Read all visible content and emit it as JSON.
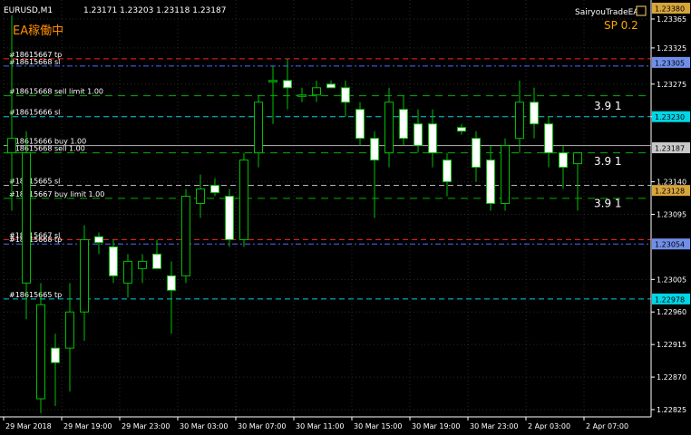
{
  "symbol_header": "EURUSD,M1",
  "ohlc": "1.23171 1.23203 1.23118 1.23187",
  "ea_status": "EA稼働中",
  "ea_name": "SairyouTradeEA",
  "spread_label": "SP 0.2",
  "colors": {
    "background": "#000000",
    "grid": "#2a2a2a",
    "bull_body": "#000000",
    "bear_body": "#ffffff",
    "candle_outline": "#00c000",
    "axis_text": "#ffffff",
    "status_text": "#ff8c00",
    "spread_text": "#ffa500",
    "tag_gold": "#d8a53b",
    "tag_blue": "#6f8fe8",
    "tag_cyan": "#00d6e6",
    "tag_magenta": "#d02873",
    "tag_gray": "#c8c8c8",
    "line_red": "#ff2020",
    "line_blue": "#4a6cff",
    "line_cyan": "#00d0e0",
    "line_green": "#00b000",
    "line_gray": "#b4b4b4",
    "ea_name_box": "#ffd966"
  },
  "chart_data": {
    "type": "candlestick",
    "ylim": [
      1.2278,
      1.2339
    ],
    "y_ticks": [
      "1.23365",
      "1.23325",
      "1.23275",
      "1.23230",
      "1.23140",
      "1.23095",
      "1.23005",
      "1.22960",
      "1.22915",
      "1.22870",
      "1.22825"
    ],
    "x_ticks": [
      "29 Mar 2018",
      "29 Mar 19:00",
      "29 Mar 23:00",
      "30 Mar 03:00",
      "30 Mar 07:00",
      "30 Mar 11:00",
      "30 Mar 15:00",
      "30 Mar 19:00",
      "30 Mar 23:00",
      "2 Apr 03:00",
      "2 Apr 07:00"
    ],
    "candles": [
      {
        "o": 1.2318,
        "h": 1.2337,
        "l": 1.231,
        "c": 1.232
      },
      {
        "o": 1.23,
        "h": 1.2321,
        "l": 1.2295,
        "c": 1.2318
      },
      {
        "o": 1.2284,
        "h": 1.23,
        "l": 1.2282,
        "c": 1.2297
      },
      {
        "o": 1.2291,
        "h": 1.2293,
        "l": 1.2283,
        "c": 1.2289
      },
      {
        "o": 1.2291,
        "h": 1.23,
        "l": 1.2285,
        "c": 1.2296
      },
      {
        "o": 1.2296,
        "h": 1.2308,
        "l": 1.2292,
        "c": 1.2306
      },
      {
        "o": 1.23064,
        "h": 1.2307,
        "l": 1.2304,
        "c": 1.23056
      },
      {
        "o": 1.2305,
        "h": 1.2306,
        "l": 1.23,
        "c": 1.2301
      },
      {
        "o": 1.23,
        "h": 1.2304,
        "l": 1.2298,
        "c": 1.2303
      },
      {
        "o": 1.2302,
        "h": 1.2304,
        "l": 1.23,
        "c": 1.2303
      },
      {
        "o": 1.2304,
        "h": 1.2306,
        "l": 1.2302,
        "c": 1.2302
      },
      {
        "o": 1.2301,
        "h": 1.2303,
        "l": 1.2293,
        "c": 1.2299
      },
      {
        "o": 1.2301,
        "h": 1.2313,
        "l": 1.23,
        "c": 1.2312
      },
      {
        "o": 1.2311,
        "h": 1.2315,
        "l": 1.2309,
        "c": 1.2313
      },
      {
        "o": 1.23135,
        "h": 1.23145,
        "l": 1.2312,
        "c": 1.23125
      },
      {
        "o": 1.2312,
        "h": 1.2313,
        "l": 1.2305,
        "c": 1.2306
      },
      {
        "o": 1.2306,
        "h": 1.2318,
        "l": 1.2305,
        "c": 1.2317
      },
      {
        "o": 1.2318,
        "h": 1.2326,
        "l": 1.2316,
        "c": 1.2325
      },
      {
        "o": 1.2328,
        "h": 1.233,
        "l": 1.2322,
        "c": 1.2328
      },
      {
        "o": 1.2328,
        "h": 1.2331,
        "l": 1.2324,
        "c": 1.2327
      },
      {
        "o": 1.2326,
        "h": 1.2327,
        "l": 1.2325,
        "c": 1.2326
      },
      {
        "o": 1.2326,
        "h": 1.2328,
        "l": 1.2325,
        "c": 1.2327
      },
      {
        "o": 1.23275,
        "h": 1.2328,
        "l": 1.2327,
        "c": 1.2327
      },
      {
        "o": 1.2327,
        "h": 1.2328,
        "l": 1.2323,
        "c": 1.2325
      },
      {
        "o": 1.2324,
        "h": 1.2325,
        "l": 1.2319,
        "c": 1.232
      },
      {
        "o": 1.232,
        "h": 1.2321,
        "l": 1.2309,
        "c": 1.2317
      },
      {
        "o": 1.2318,
        "h": 1.2327,
        "l": 1.2316,
        "c": 1.2325
      },
      {
        "o": 1.2324,
        "h": 1.2326,
        "l": 1.2319,
        "c": 1.232
      },
      {
        "o": 1.2322,
        "h": 1.2324,
        "l": 1.2318,
        "c": 1.2319
      },
      {
        "o": 1.2322,
        "h": 1.2324,
        "l": 1.2316,
        "c": 1.2318
      },
      {
        "o": 1.2317,
        "h": 1.2318,
        "l": 1.2312,
        "c": 1.2314
      },
      {
        "o": 1.23215,
        "h": 1.2322,
        "l": 1.23205,
        "c": 1.2321
      },
      {
        "o": 1.232,
        "h": 1.2321,
        "l": 1.2314,
        "c": 1.2316
      },
      {
        "o": 1.2317,
        "h": 1.2319,
        "l": 1.231,
        "c": 1.2311
      },
      {
        "o": 1.2311,
        "h": 1.232,
        "l": 1.231,
        "c": 1.2319
      },
      {
        "o": 1.232,
        "h": 1.2328,
        "l": 1.2318,
        "c": 1.2325
      },
      {
        "o": 1.2325,
        "h": 1.2327,
        "l": 1.232,
        "c": 1.2322
      },
      {
        "o": 1.2322,
        "h": 1.2323,
        "l": 1.2316,
        "c": 1.2318
      },
      {
        "o": 1.2318,
        "h": 1.2319,
        "l": 1.2313,
        "c": 1.2316
      },
      {
        "o": 1.23165,
        "h": 1.2318,
        "l": 1.231,
        "c": 1.2318
      }
    ],
    "lines": [
      {
        "label": "#18615667 tp",
        "y": 1.2331,
        "color": "line_red",
        "dash": "6,4"
      },
      {
        "label": "#18615668 sl",
        "y": 1.233,
        "color": "line_blue",
        "dash": "6,3,2,3"
      },
      {
        "label": "#18615668 sell limit 1.00",
        "y": 1.23259,
        "color": "line_green",
        "dash": "8,6"
      },
      {
        "label": "#18615666 sl",
        "y": 1.2323,
        "color": "line_cyan",
        "dash": "6,4"
      },
      {
        "label": "#18615666 buy 1.00",
        "y": 1.2319,
        "color": "line_gray",
        "dash": ""
      },
      {
        "label": "#18615668 sell 1.00",
        "y": 1.2318,
        "color": "line_green",
        "dash": "8,6"
      },
      {
        "label": "#18615665 sl",
        "y": 1.23135,
        "color": "line_gray",
        "dash": "6,4"
      },
      {
        "label": "#18615667 buy limit 1.00",
        "y": 1.23117,
        "color": "line_green",
        "dash": "8,6"
      },
      {
        "label": "#18615667 sl",
        "y": 1.2306,
        "color": "line_red",
        "dash": "6,4"
      },
      {
        "label": "#18615668 tp",
        "y": 1.23054,
        "color": "line_blue",
        "dash": "6,3,2,3"
      },
      {
        "label": "#18615665 tp",
        "y": 1.22978,
        "color": "line_cyan",
        "dash": "6,4"
      }
    ],
    "price_tags": [
      {
        "text": "1.23380",
        "y": 1.2338,
        "color": "tag_gold",
        "fg": "#000000"
      },
      {
        "text": "1.23305",
        "y": 1.23305,
        "color": "tag_blue",
        "fg": "#000000"
      },
      {
        "text": "1.23230",
        "y": 1.2323,
        "color": "tag_cyan",
        "fg": "#000000"
      },
      {
        "text": "1.23187",
        "y": 1.23187,
        "color": "tag_gray",
        "fg": "#000000"
      },
      {
        "text": "1.23128",
        "y": 1.23128,
        "color": "tag_gold",
        "fg": "#000000"
      },
      {
        "text": "1.23054",
        "y": 1.23054,
        "color": "tag_blue",
        "fg": "#000000"
      },
      {
        "text": "1.22978",
        "y": 1.22978,
        "color": "tag_cyan",
        "fg": "#000000"
      }
    ],
    "counters": [
      {
        "text": "3.9  1",
        "y": 1.23245
      },
      {
        "text": "3.9  1",
        "y": 1.23168
      },
      {
        "text": "3.9  1",
        "y": 1.2311
      }
    ]
  }
}
